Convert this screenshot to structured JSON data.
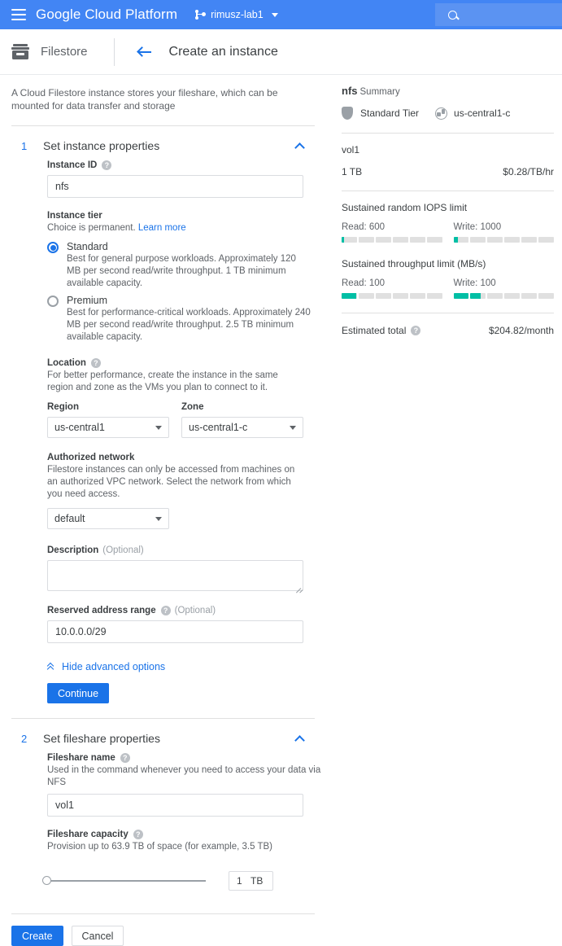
{
  "topbar": {
    "menu_icon": "hamburger-icon",
    "brand": "Google Cloud Platform",
    "project_name": "rimusz-lab1",
    "project_icon": "project-selector-icon",
    "search_icon": "search-icon",
    "search_placeholder": ""
  },
  "productbar": {
    "product_icon": "filestore-icon",
    "product_name": "Filestore",
    "back_icon": "back-arrow-icon",
    "page_title": "Create an instance"
  },
  "intro": "A Cloud Filestore instance stores your fileshare, which can be mounted for data transfer and storage",
  "section1": {
    "number": "1",
    "title": "Set instance properties",
    "collapse_icon": "chevron-up-icon",
    "instance_id": {
      "label": "Instance ID",
      "help_icon": "help-icon",
      "value": "nfs"
    },
    "instance_tier": {
      "label": "Instance tier",
      "sub": "Choice is permanent.",
      "learn_more": "Learn more",
      "options": [
        {
          "name": "Standard",
          "desc": "Best for general purpose workloads. Approximately 120 MB per second read/write throughput. 1 TB minimum available capacity.",
          "selected": true
        },
        {
          "name": "Premium",
          "desc": "Best for performance-critical workloads. Approximately 240 MB per second read/write throughput. 2.5 TB minimum available capacity.",
          "selected": false
        }
      ]
    },
    "location": {
      "label": "Location",
      "help_icon": "help-icon",
      "sub": "For better performance, create the instance in the same region and zone as the VMs you plan to connect to it.",
      "region_label": "Region",
      "region_value": "us-central1",
      "zone_label": "Zone",
      "zone_value": "us-central1-c"
    },
    "authorized_network": {
      "label": "Authorized network",
      "sub": "Filestore instances can only be accessed from machines on an authorized VPC network. Select the network from which you need access.",
      "value": "default"
    },
    "description": {
      "label": "Description",
      "optional": "(Optional)",
      "value": ""
    },
    "reserved_range": {
      "label": "Reserved address range",
      "help_icon": "help-icon",
      "optional": "(Optional)",
      "value": "10.0.0.0/29"
    },
    "hide_advanced": "Hide advanced options",
    "continue_label": "Continue"
  },
  "section2": {
    "number": "2",
    "title": "Set fileshare properties",
    "collapse_icon": "chevron-up-icon",
    "fileshare_name": {
      "label": "Fileshare name",
      "help_icon": "help-icon",
      "sub": "Used in the command whenever you need to access your data via NFS",
      "value": "vol1"
    },
    "fileshare_capacity": {
      "label": "Fileshare capacity",
      "help_icon": "help-icon",
      "sub": "Provision up to 63.9 TB of space (for example, 3.5 TB)",
      "value": "1",
      "unit": "TB",
      "slider_percent": 0
    }
  },
  "footer": {
    "create_label": "Create",
    "cancel_label": "Cancel"
  },
  "summary": {
    "name": "nfs",
    "caption": "Summary",
    "tier_icon": "shield-icon",
    "tier": "Standard Tier",
    "zone_icon": "globe-icon",
    "zone": "us-central1-c",
    "share_name": "vol1",
    "capacity": "1 TB",
    "price_rate": "$0.28/TB/hr",
    "iops_title": "Sustained random IOPS limit",
    "iops_read": "Read: 600",
    "iops_read_fill_pct": 3,
    "iops_write": "Write: 1000",
    "iops_write_fill_pct": 5,
    "throughput_title": "Sustained throughput limit (MB/s)",
    "throughput_read": "Read: 100",
    "throughput_read_fill_pct": 16,
    "throughput_write": "Write: 100",
    "throughput_write_fill_pct": 28,
    "total_label": "Estimated total",
    "total_help_icon": "help-icon",
    "total_value": "$204.82/month",
    "bar_segments": 6
  },
  "colors": {
    "brand_blue": "#4285f4",
    "link_blue": "#1a73e8",
    "teal": "#00bfa5",
    "track_gray": "#e0e0e0"
  }
}
